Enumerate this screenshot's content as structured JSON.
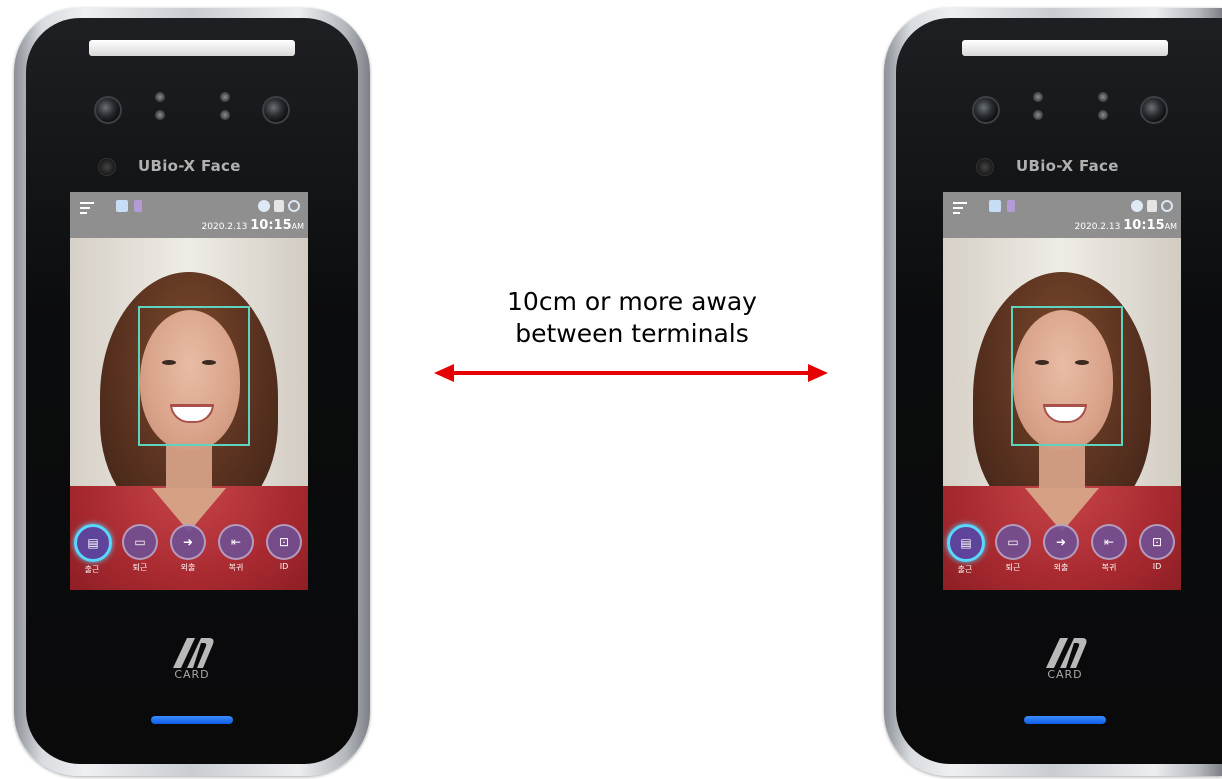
{
  "device": {
    "brand": "UBio-X Face",
    "date": "2020.2.13",
    "time": "10:15",
    "ampm": "AM",
    "card_label": "CARD",
    "buttons": [
      {
        "label": "출근",
        "icon": "document-search-icon",
        "active": true
      },
      {
        "label": "퇴근",
        "icon": "briefcase-icon",
        "active": false
      },
      {
        "label": "외출",
        "icon": "exit-arrow-icon",
        "active": false
      },
      {
        "label": "복귀",
        "icon": "return-arrow-icon",
        "active": false
      },
      {
        "label": "ID",
        "icon": "id-card-icon",
        "active": false
      }
    ]
  },
  "caption": {
    "line1": "10cm or more away",
    "line2": "between terminals"
  },
  "colors": {
    "arrow": "#e60000",
    "face_box": "#5fd3c0",
    "led": "#1f6bf0",
    "active_ring": "#58d8ff"
  }
}
